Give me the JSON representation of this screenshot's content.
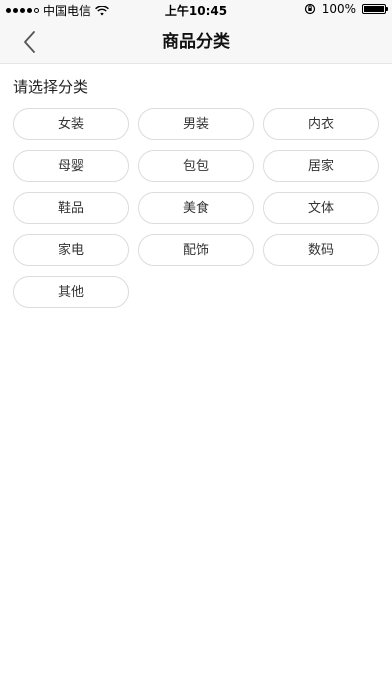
{
  "status_bar": {
    "carrier": "中国电信",
    "time": "上午10:45",
    "battery_percent": "100%",
    "battery_level": 1.0
  },
  "nav": {
    "title": "商品分类",
    "back_icon": "chevron-left-icon"
  },
  "section": {
    "title": "请选择分类"
  },
  "categories": [
    {
      "label": "女装"
    },
    {
      "label": "男装"
    },
    {
      "label": "内衣"
    },
    {
      "label": "母婴"
    },
    {
      "label": "包包"
    },
    {
      "label": "居家"
    },
    {
      "label": "鞋品"
    },
    {
      "label": "美食"
    },
    {
      "label": "文体"
    },
    {
      "label": "家电"
    },
    {
      "label": "配饰"
    },
    {
      "label": "数码"
    },
    {
      "label": "其他"
    }
  ]
}
